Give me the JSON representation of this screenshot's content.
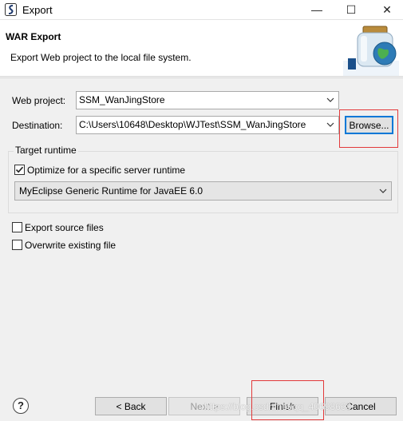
{
  "window": {
    "title": "Export",
    "minimize_glyph": "—",
    "maximize_glyph": "☐",
    "close_glyph": "✕"
  },
  "banner": {
    "title": "WAR Export",
    "description": "Export Web project to the local file system."
  },
  "form": {
    "web_project_label": "Web project:",
    "web_project_value": "SSM_WanJingStore",
    "destination_label": "Destination:",
    "destination_value": "C:\\Users\\10648\\Desktop\\WJTest\\SSM_WanJingStore",
    "browse_label": "Browse..."
  },
  "target_runtime": {
    "legend": "Target runtime",
    "optimize_label": "Optimize for a specific server runtime",
    "optimize_checked": true,
    "runtime_value": "MyEclipse Generic Runtime for JavaEE 6.0"
  },
  "options": {
    "export_source_label": "Export source files",
    "export_source_checked": false,
    "overwrite_label": "Overwrite existing file",
    "overwrite_checked": false
  },
  "footer": {
    "help_glyph": "?",
    "back_label": "< Back",
    "next_label": "Next >",
    "finish_label": "Finish",
    "cancel_label": "Cancel",
    "watermark": "https://blog.csdn.net/qq_40698668"
  },
  "colors": {
    "highlight_box": "#e2393a",
    "default_button_border": "#0078d7"
  },
  "icons": {
    "app": "myeclipse-logo-icon",
    "banner": "jar-globe-icon",
    "help": "help-icon",
    "dropdown": "chevron-down-icon",
    "check": "checkmark-icon"
  }
}
